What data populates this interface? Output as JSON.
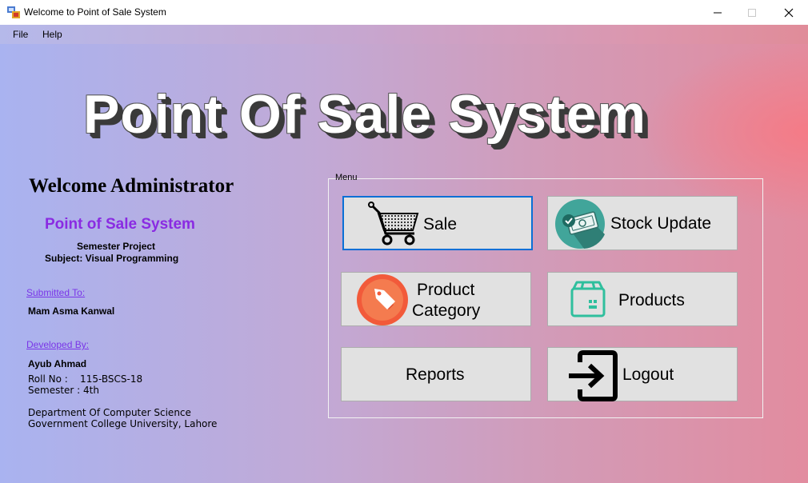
{
  "window": {
    "title": "Welcome to Point of Sale System"
  },
  "menubar": {
    "file": "File",
    "help": "Help"
  },
  "header": {
    "title": "Point Of Sale System"
  },
  "left_panel": {
    "welcome": "Welcome Administrator",
    "subtitle": "Point of Sale System",
    "project": "Semester Project",
    "subject": "Subject: Visual Programming",
    "submitted_to_label": "Submitted To:",
    "submitted_to_name": "Mam Asma Kanwal",
    "developed_by_label": "Developed By:",
    "developer_name": "Ayub Ahmad",
    "roll_no": "Roll No :    115-BSCS-18",
    "semester": "Semester : 4th",
    "department": "Department Of Computer Science",
    "university": "Government College University, Lahore"
  },
  "menu": {
    "group_label": "Menu",
    "sale": "Sale",
    "stock_update": "Stock Update",
    "product_category_line1": "Product",
    "product_category_line2": "Category",
    "products": "Products",
    "reports": "Reports",
    "logout": "Logout"
  },
  "colors": {
    "accent_purple": "#8a2be2",
    "link": "#7a35e8",
    "focus_border": "#0a6fd6"
  },
  "icons": [
    "app-icon",
    "minimize-icon",
    "maximize-icon",
    "close-icon",
    "shopping-cart-icon",
    "money-icon",
    "price-tag-icon",
    "box-icon",
    "logout-icon"
  ]
}
